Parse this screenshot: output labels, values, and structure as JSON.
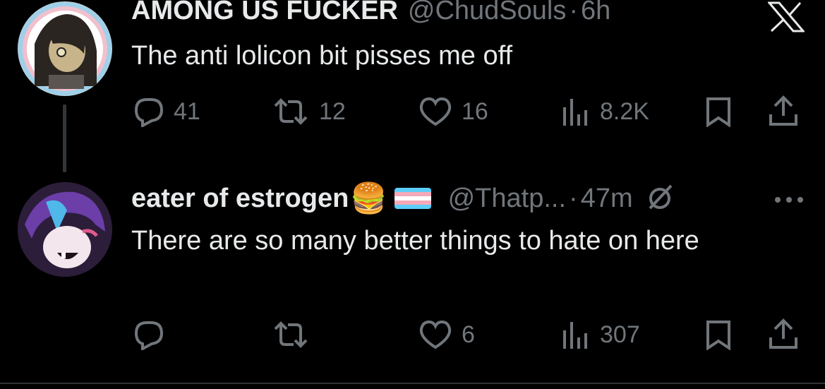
{
  "tweet1": {
    "display_name": "AMONG US FUCKER",
    "handle": "@ChudSouls",
    "separator": "·",
    "time": "6h",
    "text": "The anti lolicon bit pisses me off",
    "stats": {
      "replies": "41",
      "reposts": "12",
      "likes": "16",
      "views": "8.2K"
    },
    "icons": {
      "reply": "reply-icon",
      "repost": "repost-icon",
      "like": "heart-icon",
      "views": "views-icon",
      "bookmark": "bookmark-icon",
      "share": "share-icon"
    }
  },
  "tweet2": {
    "display_name": "eater of estrogen",
    "name_emoji": "🍔",
    "handle": "@Thatp...",
    "separator": "·",
    "time": "47m",
    "text": "There are so many better things to hate on here",
    "stats": {
      "replies": "",
      "reposts": "",
      "likes": "6",
      "views": "307"
    },
    "icons": {
      "reply": "reply-icon",
      "repost": "repost-icon",
      "like": "heart-icon",
      "views": "views-icon",
      "bookmark": "bookmark-icon",
      "share": "share-icon",
      "more": "more-icon",
      "grok": "grok-icon",
      "flag": "trans-flag-icon"
    }
  },
  "header": {
    "logo": "x-logo-icon"
  },
  "colors": {
    "background": "#000000",
    "text": "#e7e9ea",
    "muted": "#71767b",
    "trans_blue": "#5BCEFA",
    "trans_pink": "#F5A9B8"
  }
}
